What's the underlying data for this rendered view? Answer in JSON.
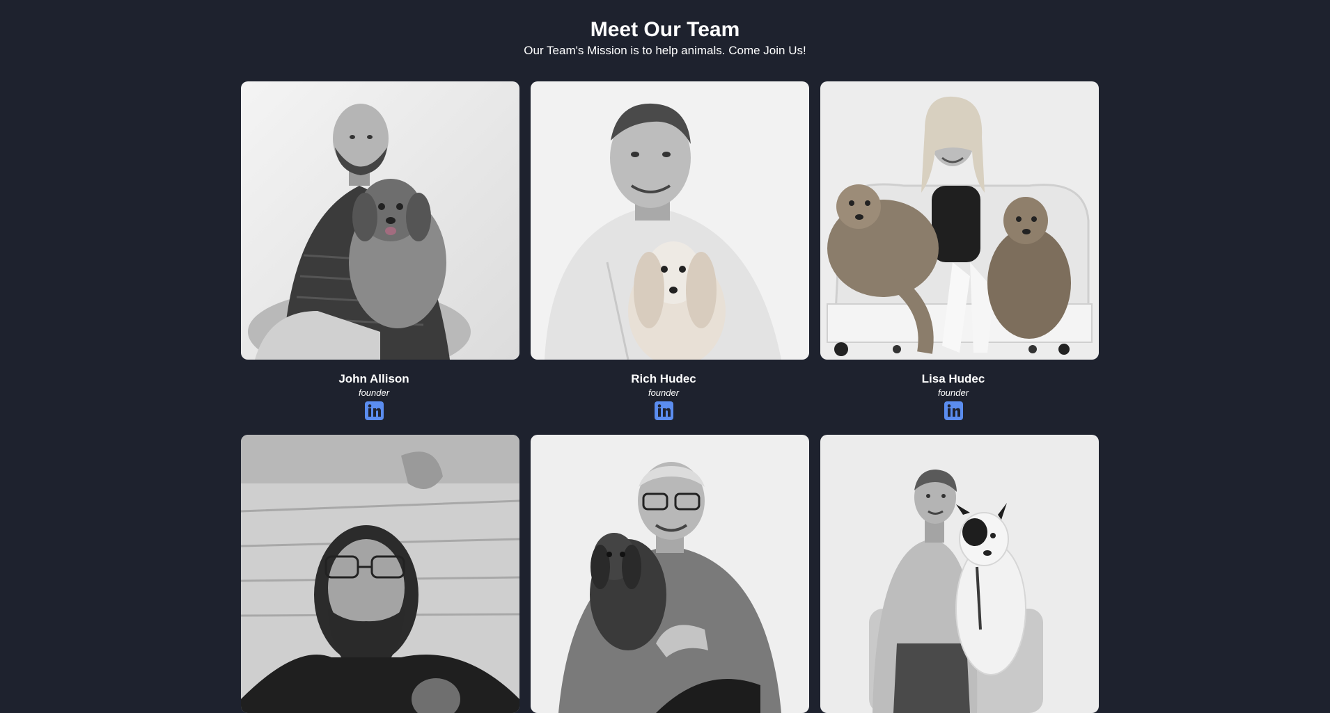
{
  "header": {
    "title": "Meet Our Team",
    "subtitle": "Our Team's Mission is to help animals. Come Join Us!"
  },
  "colors": {
    "background": "#1e222e",
    "text": "#ffffff",
    "linkedin": "#5b8def"
  },
  "team": [
    {
      "name": "John Allison",
      "role": "founder",
      "icon": "linkedin-icon"
    },
    {
      "name": "Rich Hudec",
      "role": "founder",
      "icon": "linkedin-icon"
    },
    {
      "name": "Lisa Hudec",
      "role": "founder",
      "icon": "linkedin-icon"
    },
    {
      "name": "",
      "role": "",
      "icon": ""
    },
    {
      "name": "",
      "role": "",
      "icon": ""
    },
    {
      "name": "",
      "role": "",
      "icon": ""
    }
  ]
}
